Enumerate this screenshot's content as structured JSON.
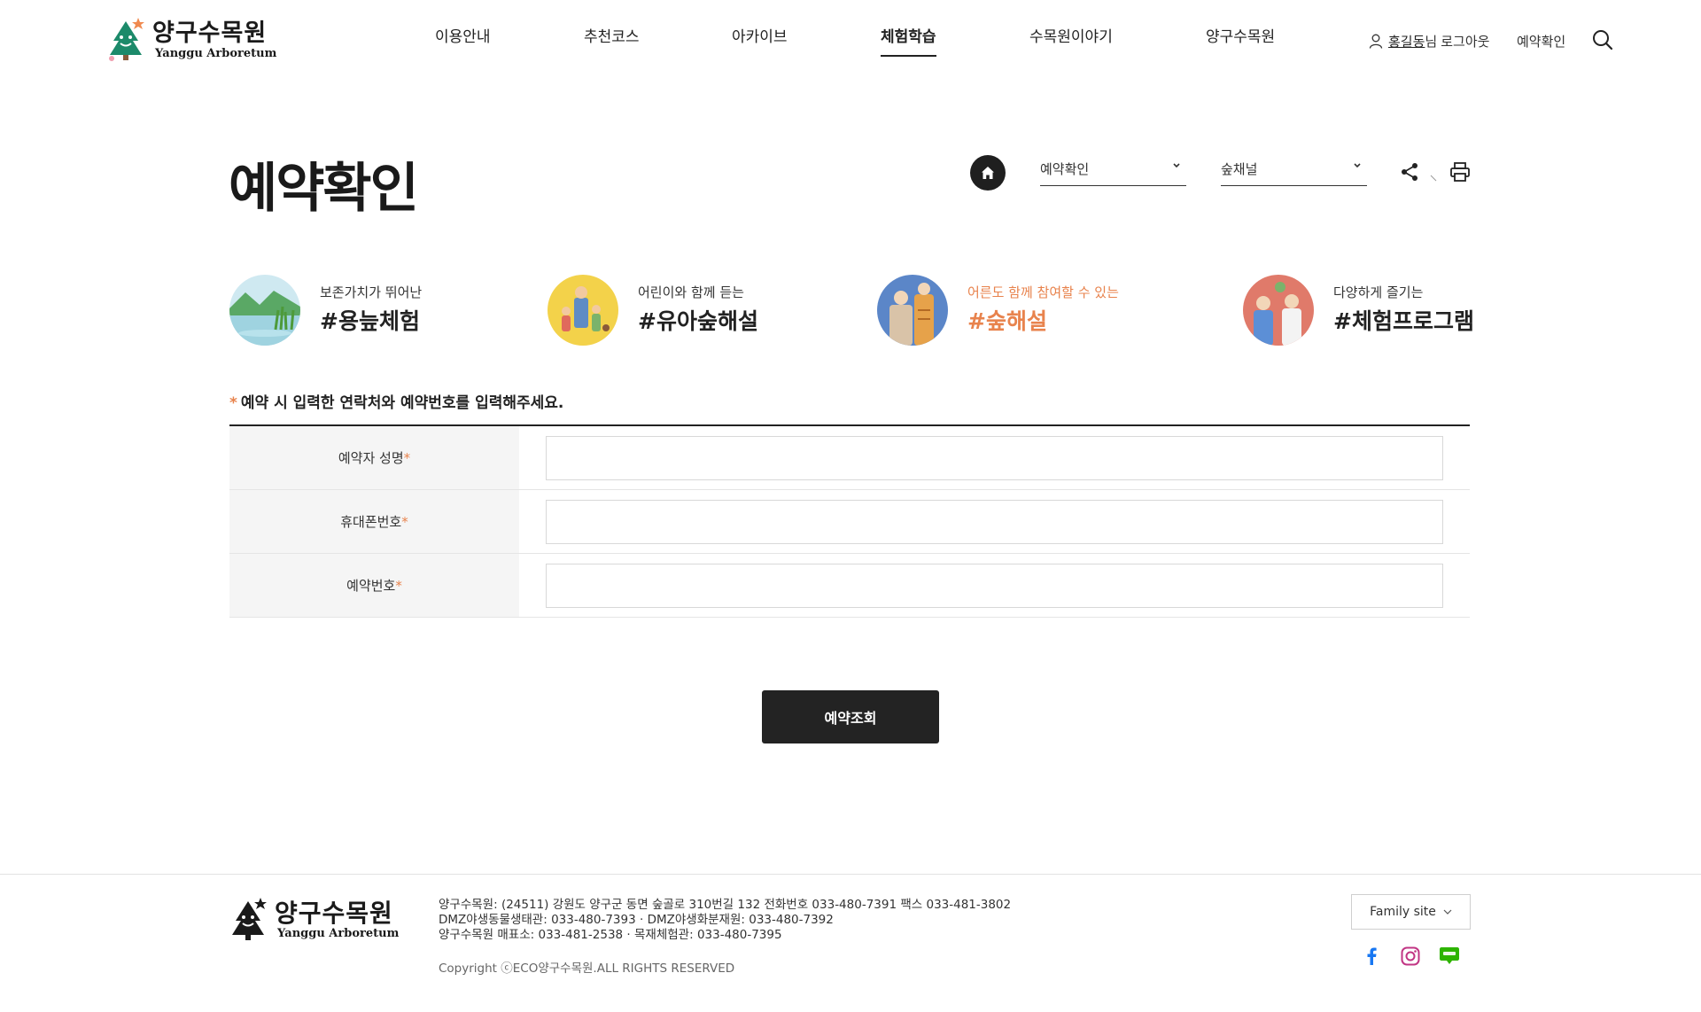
{
  "header": {
    "logo": {
      "title_ko": "양구수목원",
      "title_en": "Yanggu Arboretum"
    },
    "nav": [
      {
        "label": "이용안내"
      },
      {
        "label": "추천코스"
      },
      {
        "label": "아카이브"
      },
      {
        "label": "체험학습",
        "active": true
      },
      {
        "label": "수목원이야기"
      },
      {
        "label": "양구수목원"
      }
    ],
    "user": {
      "name": "홍길동",
      "suffix": "님",
      "logout": "로그아웃"
    },
    "reservation_link": "예약확인"
  },
  "page": {
    "title": "예약확인",
    "breadcrumb": {
      "depth1": "예약확인",
      "depth2": "숲채널"
    }
  },
  "programs": [
    {
      "sub": "보존가치가 뛰어난",
      "tag": "#용늪체험"
    },
    {
      "sub": "어린이와 함께 듣는",
      "tag": "#유아숲해설"
    },
    {
      "sub": "어른도 함께 참여할 수 있는",
      "tag": "#숲해설",
      "highlight": true
    },
    {
      "sub": "다양하게 즐기는",
      "tag": "#체험프로그램"
    }
  ],
  "form": {
    "notice_star": "*",
    "notice": "예약 시 입력한 연락처와 예약번호를 입력해주세요.",
    "fields": [
      {
        "label": "예약자 성명",
        "required": "*",
        "value": ""
      },
      {
        "label": "휴대폰번호",
        "required": "*",
        "value": ""
      },
      {
        "label": "예약번호",
        "required": "*",
        "value": ""
      }
    ],
    "submit": "예약조회"
  },
  "footer": {
    "logo": {
      "title_ko": "양구수목원",
      "title_en": "Yanggu Arboretum"
    },
    "info": [
      "양구수목원: (24511) 강원도 양구군 동면 숲골로 310번길 132 전화번호 033-480-7391 팩스 033-481-3802",
      "DMZ야생동물생태관: 033-480-7393 · DMZ야생화분재원: 033-480-7392",
      "양구수목원 매표소: 033-481-2538 · 목재체험관: 033-480-7395"
    ],
    "copyright": "Copyright ⓒECO양구수목원.ALL RIGHTS RESERVED",
    "family_site": "Family site",
    "sns": [
      "facebook-icon",
      "instagram-icon",
      "blog-icon"
    ]
  },
  "colors": {
    "accent": "#e8834d",
    "dark": "#232323",
    "label_bg": "#f5f5f5"
  }
}
